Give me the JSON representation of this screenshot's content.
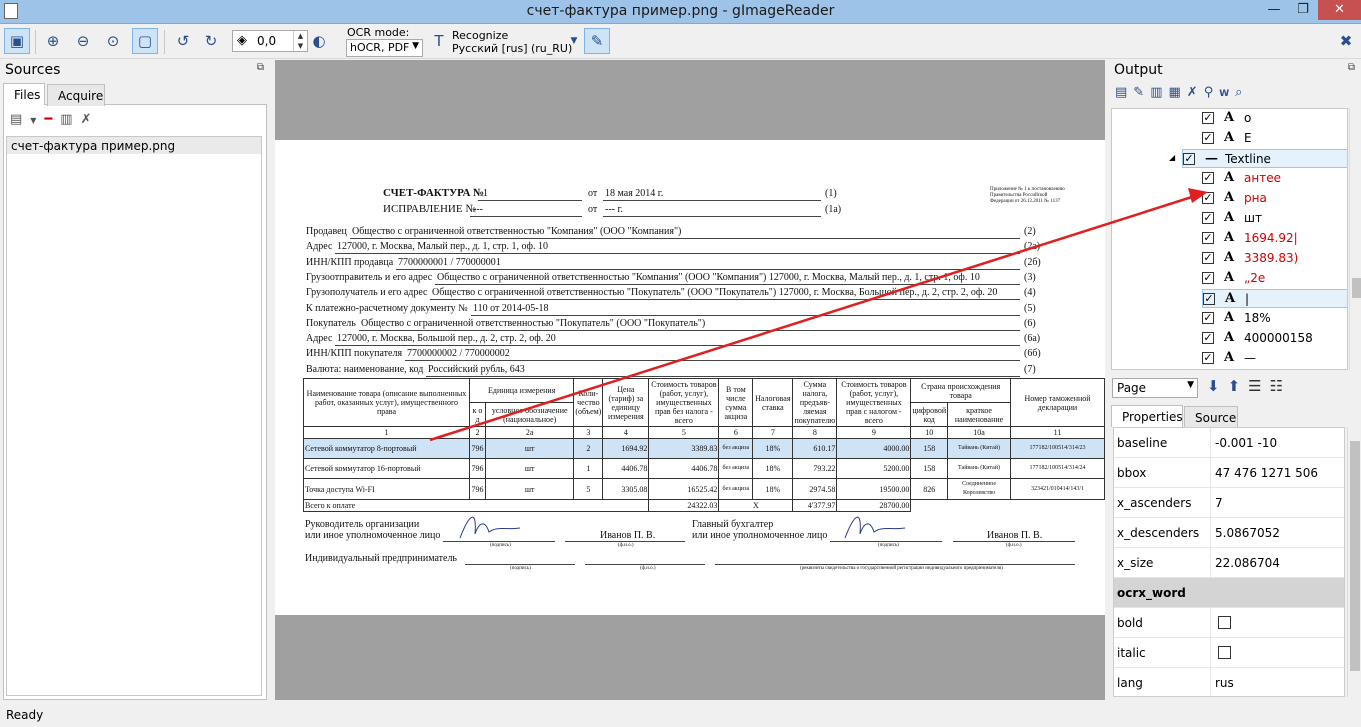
{
  "window": {
    "title": "счет-фактура пример.png - gImageReader",
    "minimize": "—",
    "maximize": "❐",
    "close": "✕"
  },
  "toolbar": {
    "rotation_value": "0,0",
    "ocr_mode_label": "OCR mode:",
    "ocr_mode_value": "hOCR, PDF",
    "recognize_label": "Recognize",
    "recognize_lang": "Русский [rus] (ru_RU)"
  },
  "sources": {
    "title": "Sources",
    "tabs": [
      "Files",
      "Acquire"
    ],
    "files": [
      "счет-фактура пример.png"
    ]
  },
  "document": {
    "header1_label": "СЧЕТ-ФАКТУРА №",
    "header1_num": "1",
    "header1_date_pre": "от",
    "header1_date": "18 мая 2014 г.",
    "header1_ref": "(1)",
    "header2_label": "ИСПРАВЛЕНИЕ №",
    "header2_num": "---",
    "header2_date": "--- г.",
    "header2_ref": "(1а)",
    "corner_note": "Приложение № 1 к постановлению Правительства Российской Федерации от 26.12.2011 № 1137",
    "lines": [
      {
        "label": "Продавец",
        "value": "Общество с ограниченной ответственностью \"Компания\" (ООО \"Компания\")",
        "ref": "(2)"
      },
      {
        "label": "Адрес",
        "value": "127000, г. Москва, Малый пер., д. 1, стр. 1, оф. 10",
        "ref": "(2а)"
      },
      {
        "label": "ИНН/КПП продавца",
        "value": "7700000001 / 770000001",
        "ref": "(2б)"
      },
      {
        "label": "Грузоотправитель и его адрес",
        "value": "Общество с ограниченной ответственностью \"Компания\" (ООО \"Компания\") 127000, г. Москва, Малый пер., д. 1, стр. 1, оф. 10",
        "ref": "(3)"
      },
      {
        "label": "Грузополучатель и его адрес",
        "value": "Общество с ограниченной ответственностью \"Покупатель\" (ООО \"Покупатель\") 127000, г. Москва, Большой пер., д. 2, стр. 2, оф. 20",
        "ref": "(4)"
      },
      {
        "label": "К платежно-расчетному документу №",
        "value": "110 от 2014-05-18",
        "ref": "(5)"
      },
      {
        "label": "Покупатель",
        "value": "Общество с ограниченной ответственностью \"Покупатель\" (ООО \"Покупатель\")",
        "ref": "(6)"
      },
      {
        "label": "Адрес",
        "value": "127000, г. Москва, Большой пер., д. 2, стр. 2, оф. 20",
        "ref": "(6а)"
      },
      {
        "label": "ИНН/КПП покупателя",
        "value": "7700000002 / 770000002",
        "ref": "(6б)"
      },
      {
        "label": "Валюта: наименование, код",
        "value": "Российский рубль, 643",
        "ref": "(7)"
      }
    ],
    "table": {
      "h_name": "Наименование товара (описание выполненных работ, оказанных услуг), имущественного права",
      "h_unit": "Единица измерения",
      "h_unit_code": "к о д",
      "h_unit_name": "условное обозначение (национальное)",
      "h_qty": "Коли-чество (объем)",
      "h_price": "Цена (тариф) за единицу измерения",
      "h_cost": "Стоимость товаров (работ, услуг), имущественных прав без налога - всего",
      "h_excise": "В том числе сумма акциза",
      "h_rate": "Налоговая ставка",
      "h_tax": "Сумма налога, предъяв-ляемая покупателю",
      "h_total": "Стоимость товаров (работ, услуг), имущественных прав с налогом - всего",
      "h_country": "Страна происхождения товара",
      "h_country_code": "цифровой код",
      "h_country_name": "краткое наименование",
      "h_customs": "Номер таможенной декларации",
      "colnums": [
        "1",
        "2",
        "2а",
        "3",
        "4",
        "5",
        "6",
        "7",
        "8",
        "9",
        "10",
        "10а",
        "11"
      ],
      "rows": [
        {
          "name": "Сетевой коммутатор 8-портовый",
          "code": "796",
          "unit": "шт",
          "qty": "2",
          "price": "1694.92",
          "cost": "3389.83",
          "excise": "без акциза",
          "rate": "18%",
          "tax": "610.17",
          "total": "4000.00",
          "ccode": "158",
          "cname": "Тайвань (Китай)",
          "decl": "177182/100514/314/23"
        },
        {
          "name": "Сетевой коммутатор 16-портовый",
          "code": "796",
          "unit": "шт",
          "qty": "1",
          "price": "4406.78",
          "cost": "4406.78",
          "excise": "без акциза",
          "rate": "18%",
          "tax": "793.22",
          "total": "5200.00",
          "ccode": "158",
          "cname": "Тайвань (Китай)",
          "decl": "177182/100514/314/24"
        },
        {
          "name": "Точка доступа Wi-FI",
          "code": "796",
          "unit": "шт",
          "qty": "5",
          "price": "3305.08",
          "cost": "16525.42",
          "excise": "без акциза",
          "rate": "18%",
          "tax": "2974.58",
          "total": "19500.00",
          "ccode": "826",
          "cname": "Соединенное Королевство",
          "decl": "323421/010414/143/1"
        }
      ],
      "total_label": "Всего к оплате",
      "total_cost": "24322.03",
      "total_excise": "X",
      "total_tax": "4'377.97",
      "total_sum": "28700.00"
    },
    "sig": {
      "head": "Руководитель организации",
      "head2": "или иное уполномоченное лицо",
      "head_name": "Иванов П. В.",
      "acc": "Главный бухгалтер",
      "acc2": "или иное уполномоченное лицо",
      "acc_name": "Иванов П. В.",
      "sign_hint": "(подпись)",
      "fio_hint": "(ф.и.о.)",
      "ip": "Индивидуальный предприниматель",
      "ip_hint": "(реквизиты свидетельства о государственной регистрации индивидуального предпринимателя)"
    }
  },
  "output": {
    "title": "Output",
    "tree": [
      {
        "icon": "A",
        "label": "о",
        "red": false
      },
      {
        "icon": "A",
        "label": "Е",
        "red": false
      },
      {
        "icon": "—",
        "label": "Textline",
        "red": false,
        "parent": true
      },
      {
        "icon": "A",
        "label": "антее",
        "red": true
      },
      {
        "icon": "A",
        "label": "рна",
        "red": true
      },
      {
        "icon": "A",
        "label": "шт",
        "red": false
      },
      {
        "icon": "A",
        "label": "1694.92|",
        "red": true
      },
      {
        "icon": "A",
        "label": "3389.83)",
        "red": true
      },
      {
        "icon": "A",
        "label": "„2е",
        "red": true
      },
      {
        "icon": "A",
        "label": "|",
        "red": false,
        "selected": true
      },
      {
        "icon": "A",
        "label": "18%",
        "red": false
      },
      {
        "icon": "A",
        "label": "400000158",
        "red": false
      },
      {
        "icon": "A",
        "label": "—",
        "red": false
      }
    ],
    "page_select": "Page",
    "props_tabs": [
      "Properties",
      "Source"
    ],
    "props": [
      {
        "k": "baseline",
        "v": "-0.001 -10"
      },
      {
        "k": "bbox",
        "v": "47 476 1271 506"
      },
      {
        "k": "x_ascenders",
        "v": "7"
      },
      {
        "k": "x_descenders",
        "v": "5.0867052"
      },
      {
        "k": "x_size",
        "v": "22.086704"
      },
      {
        "k": "ocrx_word",
        "v": "",
        "group": true
      },
      {
        "k": "bold",
        "v": "",
        "check": true
      },
      {
        "k": "italic",
        "v": "",
        "check": true
      },
      {
        "k": "lang",
        "v": "rus"
      }
    ]
  },
  "status": "Ready",
  "colors": {
    "accent": "#9ec3e8",
    "arrow": "#e02020",
    "highlight": "#cfe3f7"
  }
}
